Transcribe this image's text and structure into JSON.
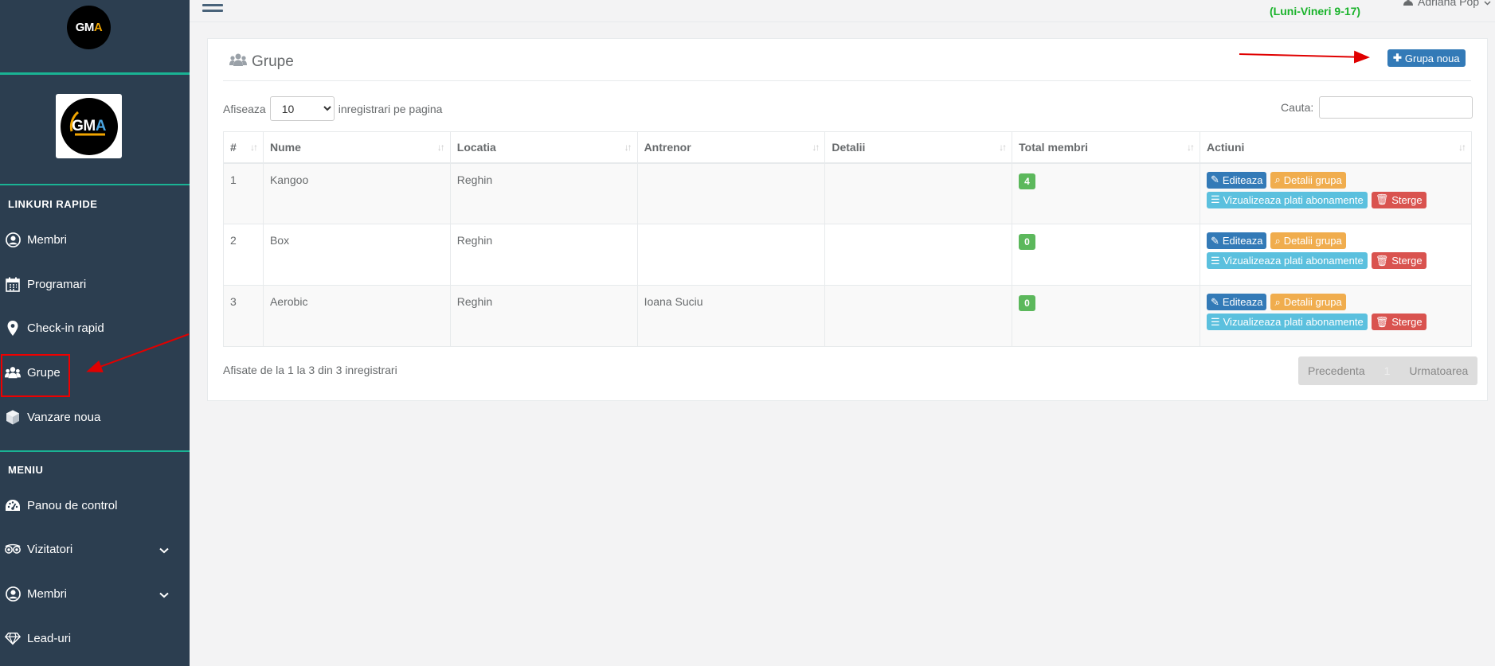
{
  "sidebar": {
    "logo_text": "GM",
    "logo_accent": "A",
    "quick_links_title": "LINKURI RAPIDE",
    "quick_links": [
      {
        "label": "Membri",
        "icon": "user-circle-icon"
      },
      {
        "label": "Programari",
        "icon": "calendar-icon"
      },
      {
        "label": "Check-in rapid",
        "icon": "map-marker-icon"
      },
      {
        "label": "Grupe",
        "icon": "users-icon"
      },
      {
        "label": "Vanzare noua",
        "icon": "cube-icon"
      }
    ],
    "menu_title": "MENIU",
    "menu": [
      {
        "label": "Panou de control",
        "icon": "dashboard-icon"
      },
      {
        "label": "Vizitatori",
        "icon": "tripadvisor-icon"
      },
      {
        "label": "Membri",
        "icon": "user-circle-icon"
      },
      {
        "label": "Lead-uri",
        "icon": "diamond-icon"
      }
    ]
  },
  "topbar": {
    "hours": "(Luni-Vineri 9-17)",
    "user": "Adriana Pop"
  },
  "panel": {
    "title": "Grupe",
    "new_button": "Grupa noua",
    "show_label": "Afiseaza",
    "page_size": "10",
    "per_page_label": "inregistrari pe pagina",
    "search_label": "Cauta:",
    "search_value": ""
  },
  "table": {
    "headers": [
      "#",
      "Nume",
      "Locatia",
      "Antrenor",
      "Detalii",
      "Total membri",
      "Actiuni"
    ],
    "rows": [
      {
        "id": "1",
        "name": "Kangoo",
        "location": "Reghin",
        "trainer": "",
        "details": "",
        "members": "4"
      },
      {
        "id": "2",
        "name": "Box",
        "location": "Reghin",
        "trainer": "",
        "details": "",
        "members": "0"
      },
      {
        "id": "3",
        "name": "Aerobic",
        "location": "Reghin",
        "trainer": "Ioana Suciu",
        "details": "",
        "members": "0"
      }
    ],
    "actions": {
      "edit": "Editeaza",
      "details": "Detalii grupa",
      "payments": "Vizualizeaza plati abonamente",
      "delete": "Sterge"
    }
  },
  "footer": {
    "info": "Afisate de la 1 la 3 din 3 inregistrari",
    "prev": "Precedenta",
    "page": "1",
    "next": "Urmatoarea"
  },
  "colors": {
    "sidebar_bg": "#2c3e50",
    "accent_green": "#1ab394",
    "primary": "#337ab7",
    "warning": "#f0ad4e",
    "info": "#5bc0de",
    "danger": "#d9534f",
    "annotation_red": "#e00000"
  }
}
